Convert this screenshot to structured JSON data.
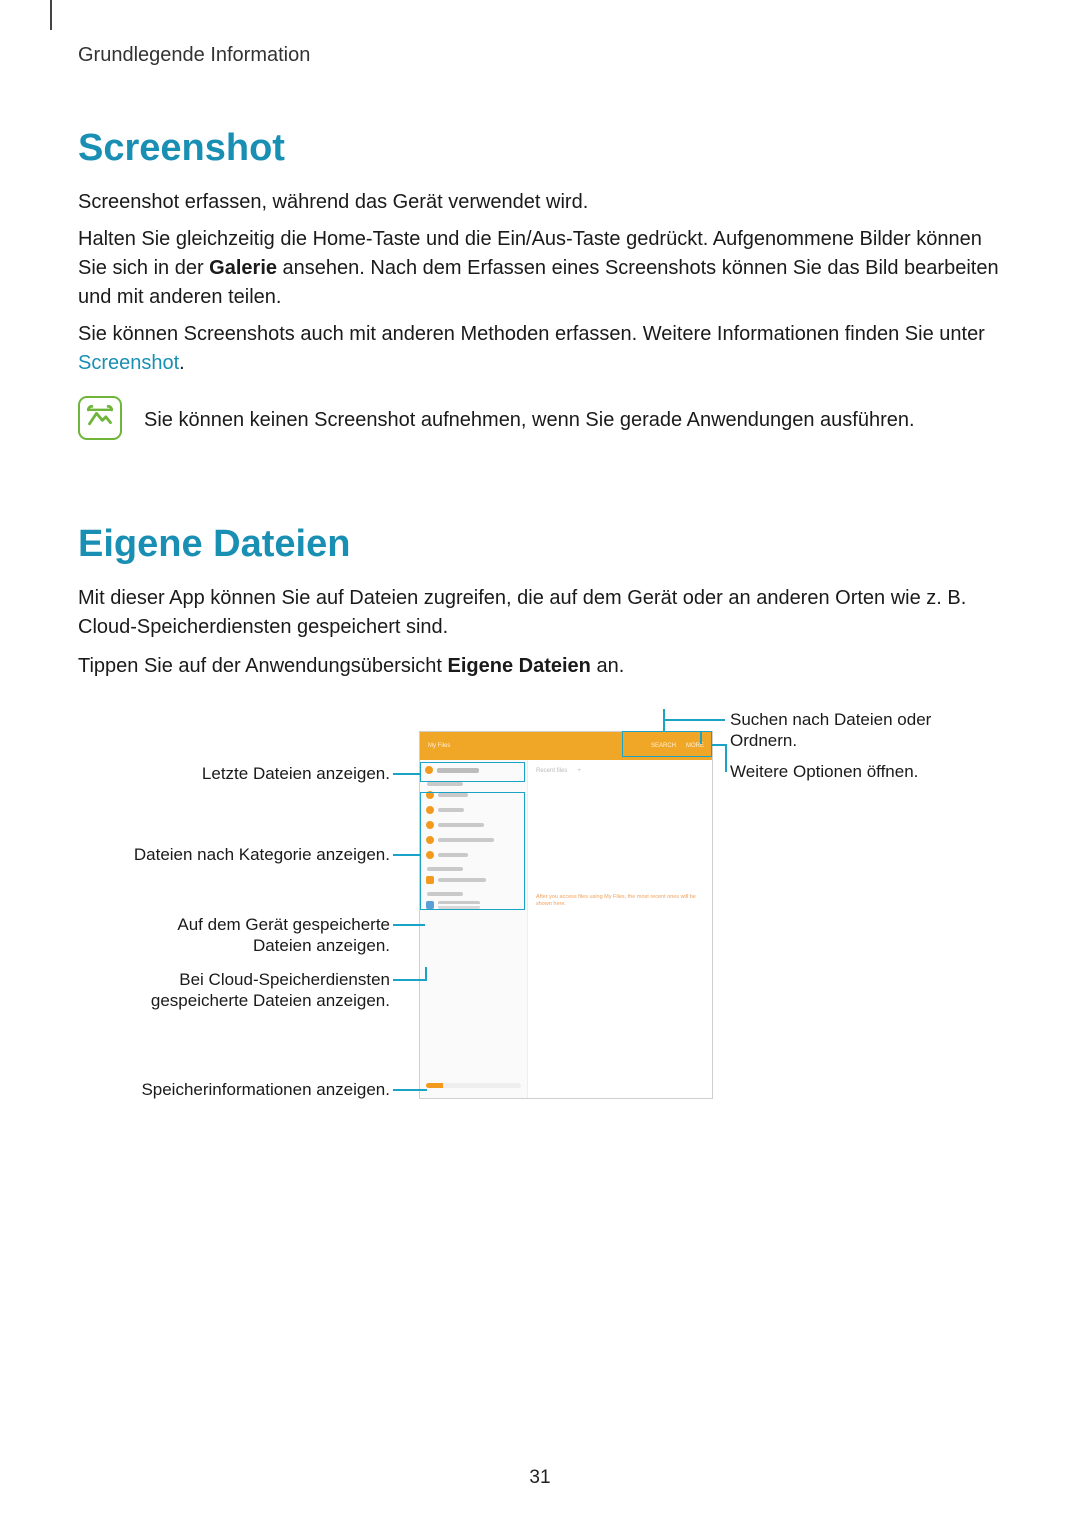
{
  "breadcrumb": "Grundlegende Information",
  "section1": {
    "heading": "Screenshot",
    "p1": "Screenshot erfassen, während das Gerät verwendet wird.",
    "p2_a": "Halten Sie gleichzeitig die Home-Taste und die Ein/Aus-Taste gedrückt. Aufgenommene Bilder können Sie sich in der ",
    "p2_bold": "Galerie",
    "p2_b": " ansehen. Nach dem Erfassen eines Screenshots können Sie das Bild bearbeiten und mit anderen teilen.",
    "p3_a": "Sie können Screenshots auch mit anderen Methoden erfassen. Weitere Informationen finden Sie unter ",
    "p3_link": "Screenshot",
    "p3_b": ".",
    "note": "Sie können keinen Screenshot aufnehmen, wenn Sie gerade Anwendungen ausführen."
  },
  "section2": {
    "heading": "Eigene Dateien",
    "p1": "Mit dieser App können Sie auf Dateien zugreifen, die auf dem Gerät oder an anderen Orten wie z. B. Cloud-Speicherdiensten gespeichert sind.",
    "p2_a": "Tippen Sie auf der Anwendungsübersicht ",
    "p2_bold": "Eigene Dateien",
    "p2_b": " an."
  },
  "callouts": {
    "recent": "Letzte Dateien anzeigen.",
    "category": "Dateien nach Kategorie anzeigen.",
    "device": "Auf dem Gerät gespeicherte Dateien anzeigen.",
    "cloud": "Bei Cloud-Speicherdiensten gespeicherte Dateien anzeigen.",
    "storage": "Speicherinformationen anzeigen.",
    "search": "Suchen nach Dateien oder Ordnern.",
    "more": "Weitere Optionen öffnen."
  },
  "device_ui": {
    "title": "My Files",
    "search": "SEARCH",
    "more": "MORE",
    "recent": "Recent files",
    "tab_recent": "Recent files",
    "plus": "+"
  },
  "page_number": "31"
}
